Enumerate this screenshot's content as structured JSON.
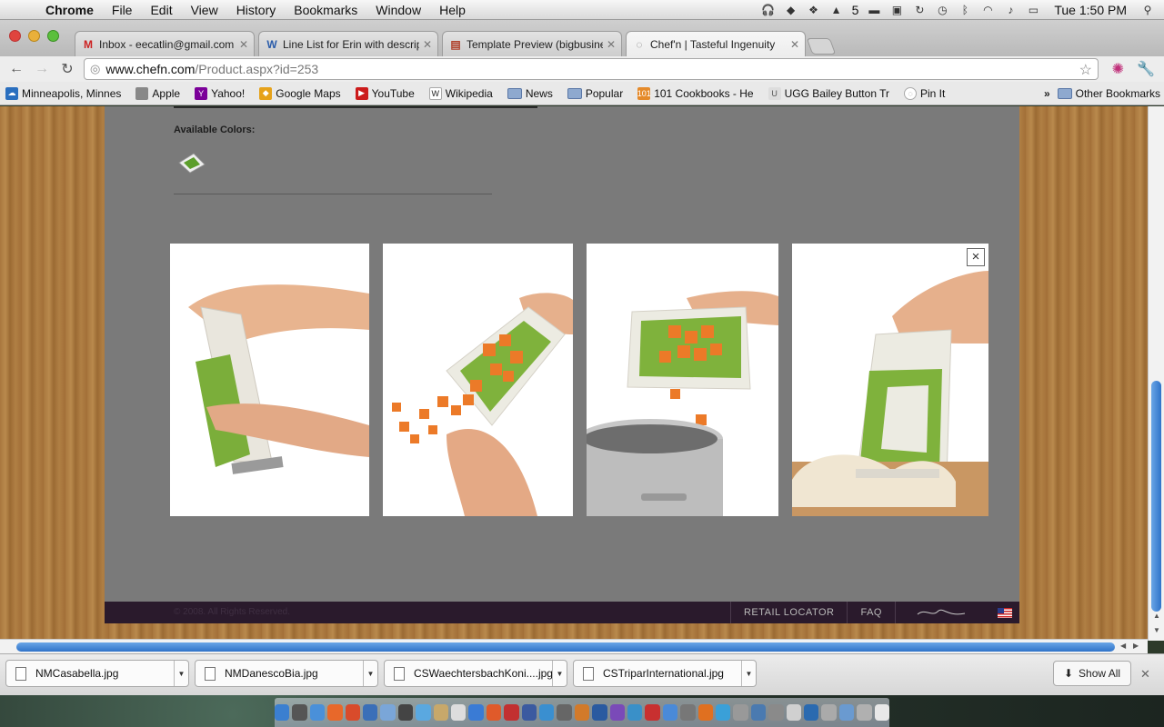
{
  "menubar": {
    "app_name": "Chrome",
    "menus": [
      "File",
      "Edit",
      "View",
      "History",
      "Bookmarks",
      "Window",
      "Help"
    ],
    "status_text": "5",
    "clock": "Tue 1:50 PM"
  },
  "tabs": [
    {
      "title": "Inbox - eecatlin@gmail.com",
      "icon": "gmail-icon"
    },
    {
      "title": "Line List for Erin with descrip",
      "icon": "word-icon"
    },
    {
      "title": "Template Preview (bigbusine",
      "icon": "template-icon"
    },
    {
      "title": "Chef'n | Tasteful Ingenuity",
      "icon": "globe-icon",
      "active": true
    }
  ],
  "omnibox": {
    "host": "www.chefn.com",
    "path": "/Product.aspx?id=253"
  },
  "bookmarks": [
    {
      "label": "Minneapolis, Minnes",
      "icon": "weather-icon",
      "color": "#2a6fbf"
    },
    {
      "label": "Apple",
      "icon": "apple-icon",
      "color": "#888888"
    },
    {
      "label": "Yahoo!",
      "icon": "yahoo-icon",
      "color": "#7b0099"
    },
    {
      "label": "Google Maps",
      "icon": "maps-icon",
      "color": "#e6a21a"
    },
    {
      "label": "YouTube",
      "icon": "youtube-icon",
      "color": "#cc1b1b"
    },
    {
      "label": "Wikipedia",
      "icon": "wikipedia-icon",
      "color": "#444444"
    },
    {
      "label": "News",
      "icon": "folder-icon"
    },
    {
      "label": "Popular",
      "icon": "folder-icon"
    },
    {
      "label": "101 Cookbooks - He",
      "icon": "cookbooks-icon",
      "color": "#e58a2a"
    },
    {
      "label": "UGG Bailey Button Tr",
      "icon": "ugg-icon",
      "color": "#cccccc"
    },
    {
      "label": "Pin It",
      "icon": "pin-icon",
      "color": "#999999"
    }
  ],
  "other_bookmarks": "Other Bookmarks",
  "page": {
    "available_colors_label": "Available Colors:",
    "swatch_color": "#5c9e2b",
    "photos": [
      {
        "name": "photo-scraper-hands",
        "alt": "hands holding cutting board"
      },
      {
        "name": "photo-carrots-pour",
        "alt": "pouring diced carrots"
      },
      {
        "name": "photo-carrots-pot",
        "alt": "carrots into pot"
      },
      {
        "name": "photo-dough-scraper",
        "alt": "scraping dough"
      }
    ],
    "close_symbol": "×",
    "copyright": "© 2008. All Rights Reserved.",
    "footer_links": [
      "RETAIL LOCATOR",
      "FAQ"
    ]
  },
  "downloads": [
    {
      "filename": "NMCasabella.jpg"
    },
    {
      "filename": "NMDanescoBia.jpg"
    },
    {
      "filename": "CSWaechtersbachKoni....jpg"
    },
    {
      "filename": "CSTriparInternational.jpg"
    }
  ],
  "show_all": "Show All",
  "dock_icon_colors": [
    "#3b7fd0",
    "#555555",
    "#4a90d9",
    "#e8682a",
    "#d94b2b",
    "#3a6fb8",
    "#7aa6d8",
    "#444444",
    "#5aa8e0",
    "#c8a86a",
    "#dddddd",
    "#3a7bd5",
    "#e05a2a",
    "#c23030",
    "#3b5aa0",
    "#3a8fd0",
    "#666666",
    "#d27a2a",
    "#2a5aa0",
    "#7a4ab8",
    "#3a90c8",
    "#c83030",
    "#4a8ad8",
    "#777777",
    "#e07020",
    "#3aa0d8",
    "#999999",
    "#4a7ab0",
    "#8a8a8a",
    "#d0d0d0",
    "#2a6ab0",
    "#aaaaaa",
    "#6a9ad0",
    "#b0b0b0",
    "#e8e8e8"
  ]
}
